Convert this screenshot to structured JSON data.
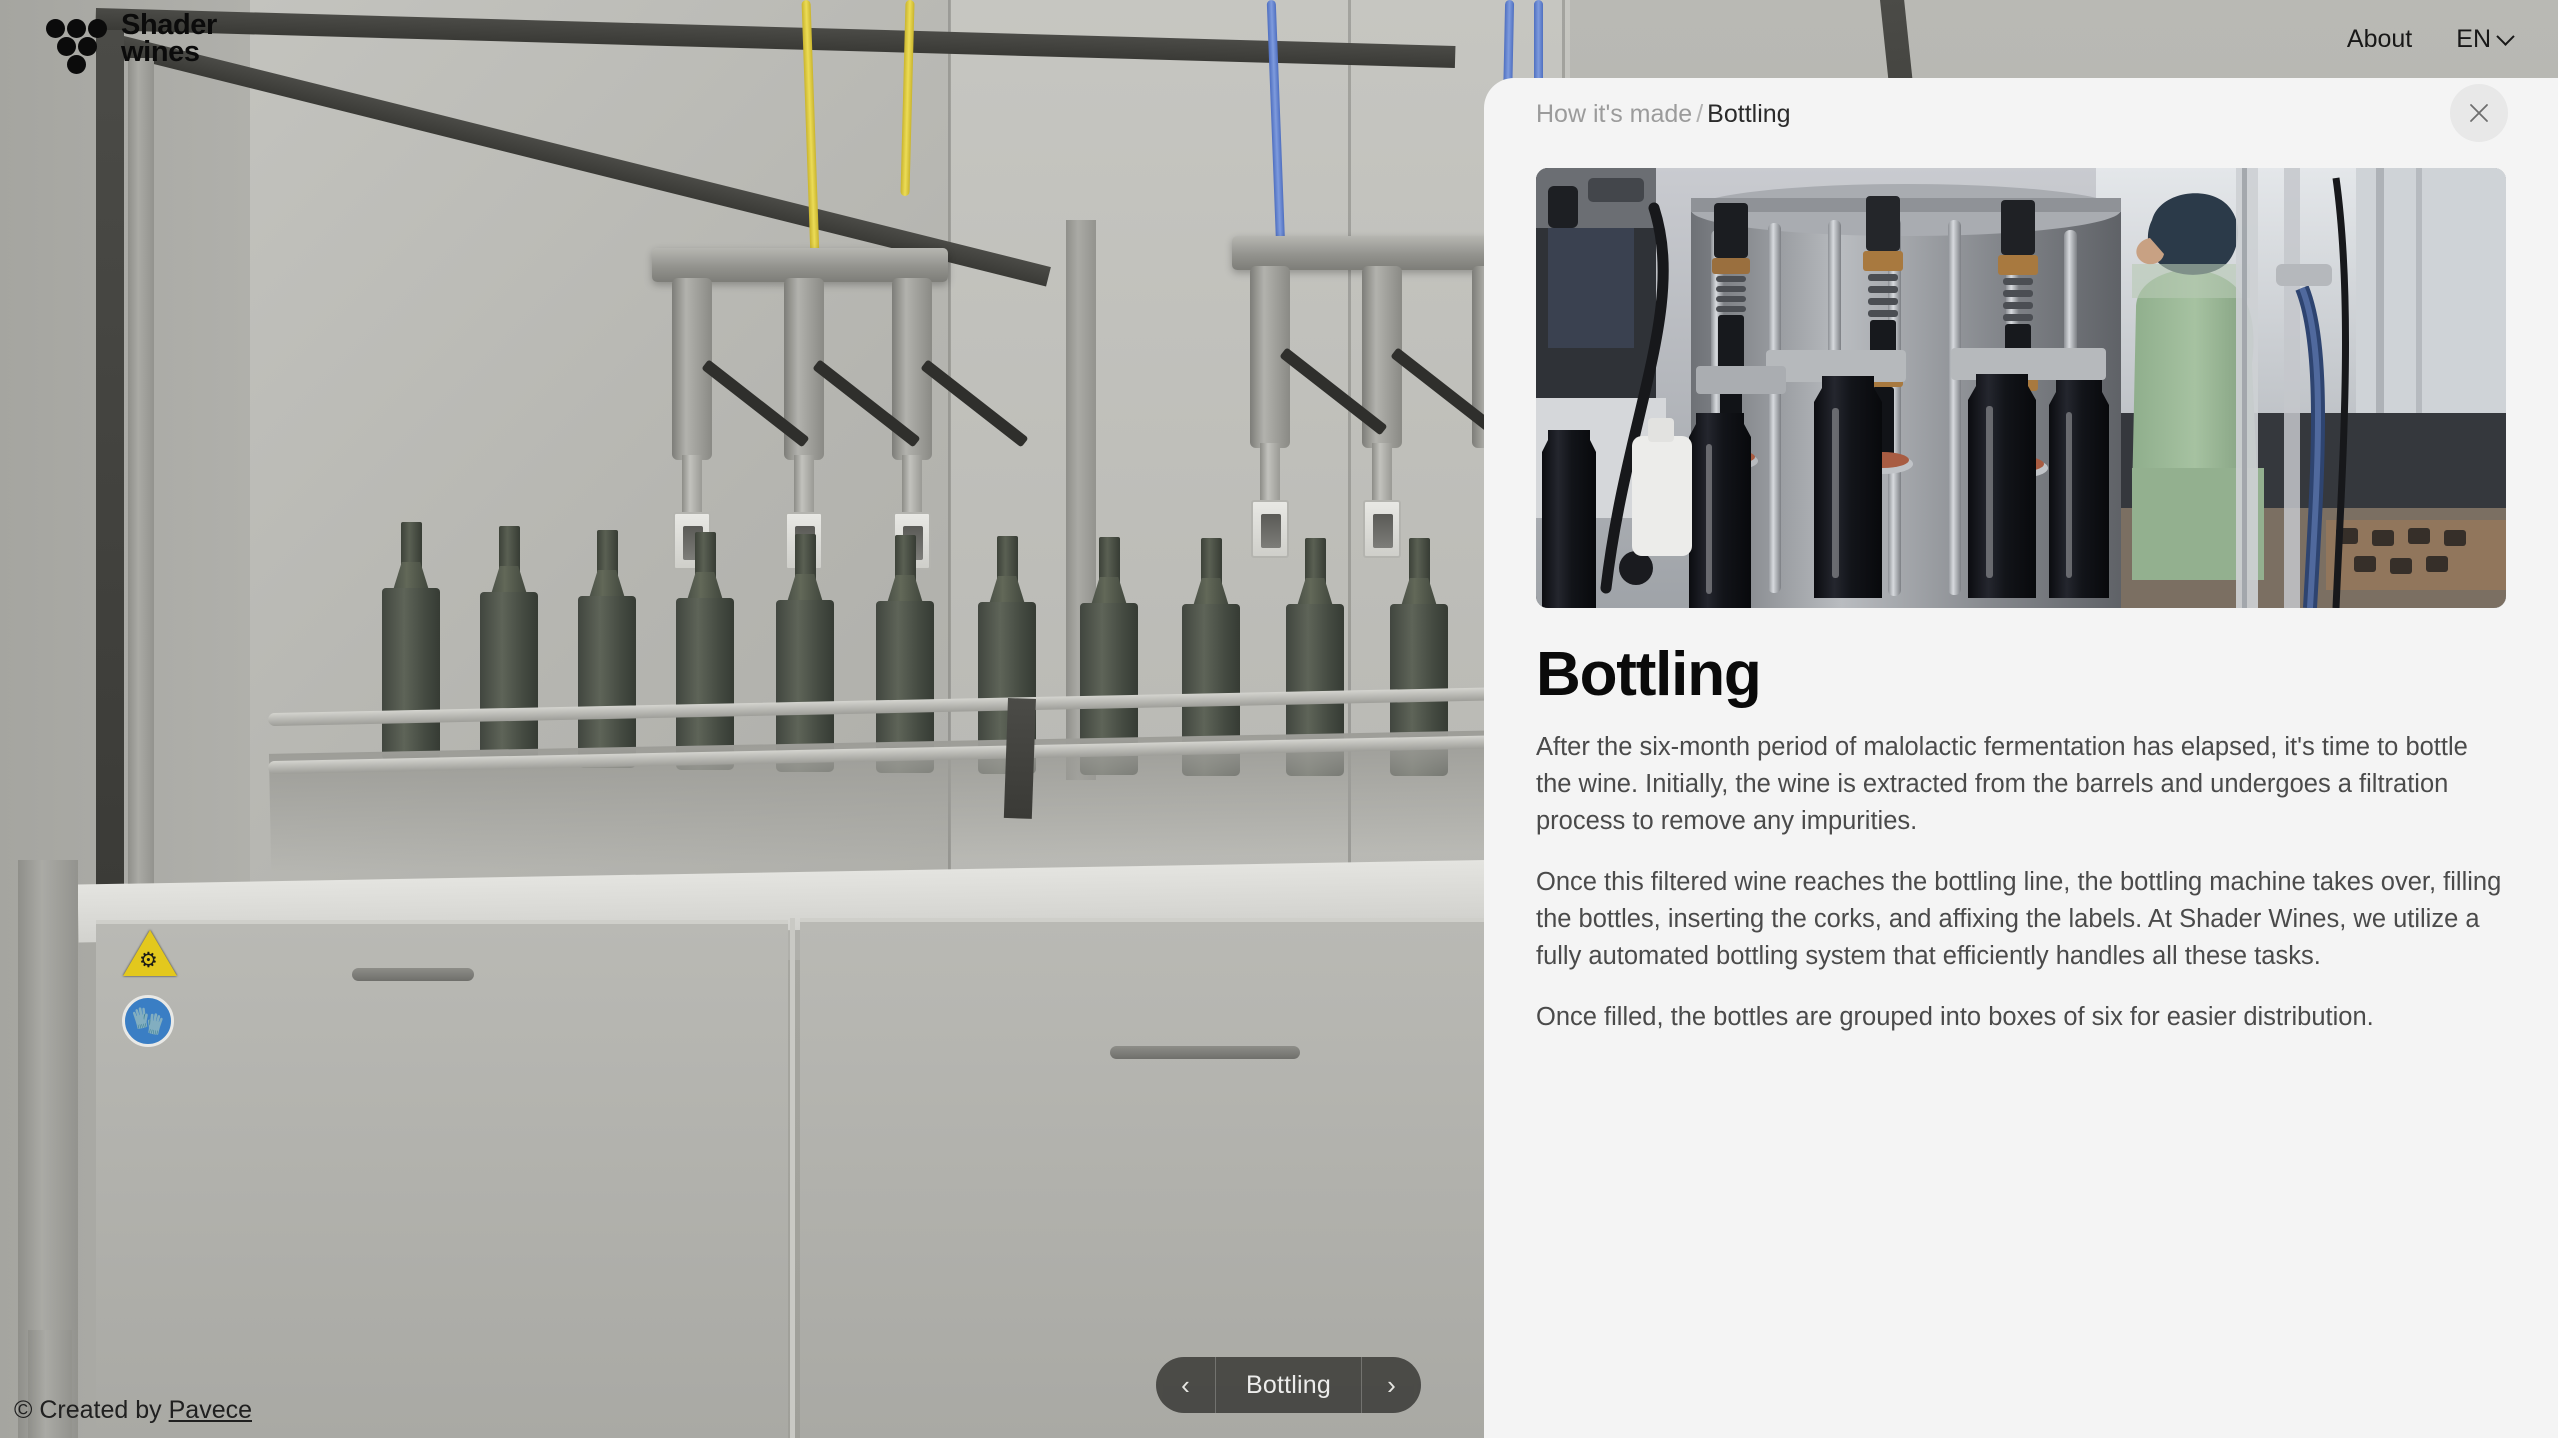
{
  "header": {
    "logo": {
      "name": "Shader wines",
      "line1": "Shader",
      "line2": "wines"
    },
    "nav": [
      {
        "label": "About",
        "name": "nav-about"
      }
    ],
    "language": {
      "code": "EN",
      "icon": "chevron-down-icon"
    }
  },
  "scene": {
    "name": "bottling-line-3d-scene",
    "credit_prefix": "© Created by ",
    "credit_link": "Pavece",
    "safety_signs": [
      {
        "name": "crush-hazard-warning-sticker",
        "type": "warning-triangle",
        "color": "#e3c81d"
      },
      {
        "name": "wear-gloves-mandatory-sticker",
        "type": "blue-circle",
        "color": "#3a7ec4"
      }
    ]
  },
  "stage_nav": {
    "prev_icon": "chevron-left-icon",
    "next_icon": "chevron-right-icon",
    "current_label": "Bottling"
  },
  "panel": {
    "breadcrumb": {
      "parent": "How it's made",
      "separator": "/",
      "current": "Bottling"
    },
    "close": {
      "icon": "close-icon",
      "label": "Close"
    },
    "hero_image": {
      "name": "bottling-machine-photo",
      "alt": "Automated bottling machine filling dark wine bottles with a worker in a green shirt"
    },
    "title": "Bottling",
    "paragraphs": [
      "After the six-month period of malolactic fermentation has elapsed, it's time to bottle the wine. Initially, the wine is extracted from the barrels and undergoes a filtration process to remove any impurities.",
      "Once this filtered wine reaches the bottling line, the bottling machine takes over, filling the bottles, inserting the corks, and affixing the labels. At Shader Wines, we utilize a fully automated bottling system that efficiently handles all these tasks.",
      "Once filled, the bottles are grouped into boxes of six for easier distribution."
    ]
  },
  "colors": {
    "panel_bg": "#f4f4f4",
    "text_primary": "#0a0a0a",
    "text_body": "#4a4a4a",
    "text_muted": "#9b9b9b",
    "pill_bg": "rgba(38,38,34,.72)"
  }
}
